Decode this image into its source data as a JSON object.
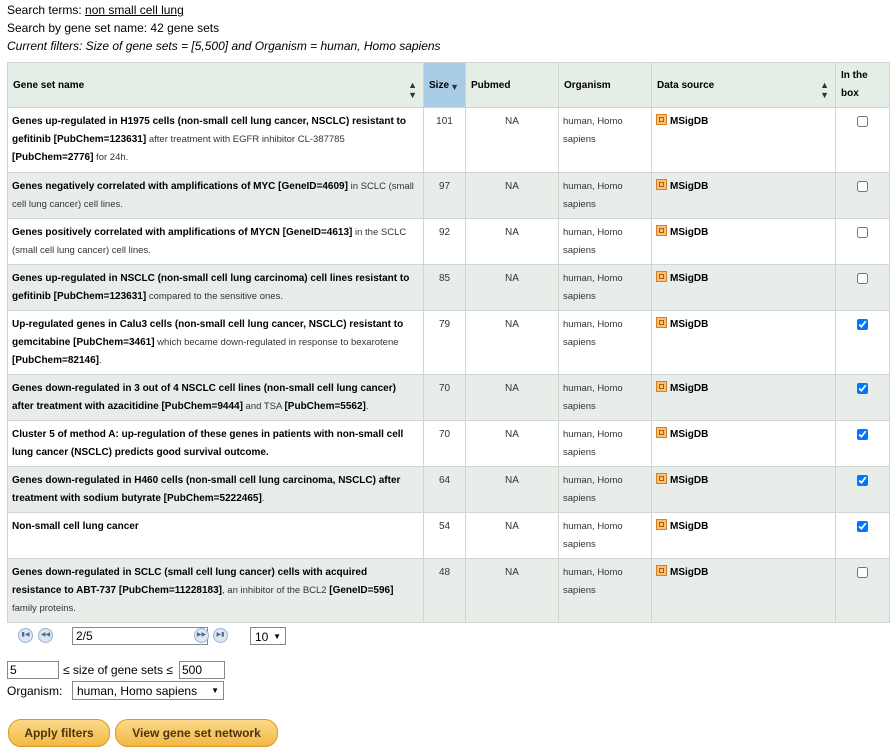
{
  "header": {
    "search_label": "Search terms: ",
    "search_terms": "non small cell lung",
    "search_result": "Search by gene set name: 42 gene sets",
    "filters": "Current filters: Size of gene sets = [5,500] and Organism = human, Homo sapiens"
  },
  "table": {
    "columns": {
      "name": "Gene set name",
      "size": "Size",
      "pubmed": "Pubmed",
      "organism": "Organism",
      "source": "Data source",
      "inbox": "In the box"
    },
    "rows": [
      {
        "name_parts": [
          {
            "t": "Genes up-regulated in H1975 cells (non-small cell lung cancer, NSCLC) resistant to gefitinib [PubChem=123631]",
            "b": true
          },
          {
            "t": " after treatment with EGFR inhibitor CL-387785 ",
            "b": false
          },
          {
            "t": "[PubChem=2776]",
            "b": true
          },
          {
            "t": " for 24h.",
            "b": false
          }
        ],
        "size": "101",
        "pubmed": "NA",
        "organism": "human, Homo sapiens",
        "source": "MSigDB",
        "checked": false
      },
      {
        "name_parts": [
          {
            "t": "Genes negatively correlated with amplifications of MYC [GeneID=4609]",
            "b": true
          },
          {
            "t": " in SCLC (small cell lung cancer) cell lines.",
            "b": false
          }
        ],
        "size": "97",
        "pubmed": "NA",
        "organism": "human, Homo sapiens",
        "source": "MSigDB",
        "checked": false
      },
      {
        "name_parts": [
          {
            "t": "Genes positively correlated with amplifications of MYCN [GeneID=4613]",
            "b": true
          },
          {
            "t": " in the SCLC (small cell lung cancer) cell lines.",
            "b": false
          }
        ],
        "size": "92",
        "pubmed": "NA",
        "organism": "human, Homo sapiens",
        "source": "MSigDB",
        "checked": false
      },
      {
        "name_parts": [
          {
            "t": "Genes up-regulated in NSCLC (non-small cell lung carcinoma) cell lines resistant to gefitinib [PubChem=123631]",
            "b": true
          },
          {
            "t": " compared to the sensitive ones.",
            "b": false
          }
        ],
        "size": "85",
        "pubmed": "NA",
        "organism": "human, Homo sapiens",
        "source": "MSigDB",
        "checked": false
      },
      {
        "name_parts": [
          {
            "t": "Up-regulated genes in Calu3 cells (non-small cell lung cancer, NSCLC) resistant to gemcitabine [PubChem=3461]",
            "b": true
          },
          {
            "t": " which became down-regulated in response to bexarotene ",
            "b": false
          },
          {
            "t": "[PubChem=82146]",
            "b": true
          },
          {
            "t": ".",
            "b": false
          }
        ],
        "size": "79",
        "pubmed": "NA",
        "organism": "human, Homo sapiens",
        "source": "MSigDB",
        "checked": true
      },
      {
        "name_parts": [
          {
            "t": "Genes down-regulated in 3 out of 4 NSCLC cell lines (non-small cell lung cancer) after treatment with azacitidine [PubChem=9444]",
            "b": true
          },
          {
            "t": " and TSA ",
            "b": false
          },
          {
            "t": "[PubChem=5562]",
            "b": true
          },
          {
            "t": ".",
            "b": false
          }
        ],
        "size": "70",
        "pubmed": "NA",
        "organism": "human, Homo sapiens",
        "source": "MSigDB",
        "checked": true
      },
      {
        "name_parts": [
          {
            "t": "Cluster 5 of method A: up-regulation of these genes in patients with non-small cell lung cancer (NSCLC) predicts good survival outcome.",
            "b": true
          }
        ],
        "size": "70",
        "pubmed": "NA",
        "organism": "human, Homo sapiens",
        "source": "MSigDB",
        "checked": true
      },
      {
        "name_parts": [
          {
            "t": "Genes down-regulated in H460 cells (non-small cell lung carcinoma, NSCLC) after treatment with sodium butyrate [PubChem=5222465]",
            "b": true
          },
          {
            "t": ".",
            "b": false
          }
        ],
        "size": "64",
        "pubmed": "NA",
        "organism": "human, Homo sapiens",
        "source": "MSigDB",
        "checked": true
      },
      {
        "name_parts": [
          {
            "t": "Non-small cell lung cancer",
            "b": true
          }
        ],
        "size": "54",
        "pubmed": "NA",
        "organism": "human, Homo sapiens",
        "source": "MSigDB",
        "checked": true
      },
      {
        "name_parts": [
          {
            "t": "Genes down-regulated in SCLC (small cell lung cancer) cells with acquired resistance to ABT-737 [PubChem=11228183]",
            "b": true
          },
          {
            "t": ", an inhibitor of the BCL2 ",
            "b": false
          },
          {
            "t": "[GeneID=596]",
            "b": true
          },
          {
            "t": " family proteins.",
            "b": false
          }
        ],
        "size": "48",
        "pubmed": "NA",
        "organism": "human, Homo sapiens",
        "source": "MSigDB",
        "checked": false
      }
    ]
  },
  "pager": {
    "page_value": "2/5",
    "per_page": "10",
    "first_icon": "first-page-icon",
    "prev_icon": "prev-page-icon",
    "next_icon": "next-page-icon",
    "last_icon": "last-page-icon"
  },
  "filters": {
    "min_size": "5",
    "size_label": "≤ size of gene sets ≤",
    "max_size": "500",
    "organism_label": "Organism:",
    "organism_value": "human, Homo sapiens"
  },
  "buttons": {
    "apply": "Apply filters",
    "network": "View gene set network"
  },
  "colors": {
    "header_bg": "#e4eee6",
    "sorted_header_bg": "#a8cce6",
    "even_row_bg": "#e9edea",
    "button_bg": "#f3b843"
  }
}
